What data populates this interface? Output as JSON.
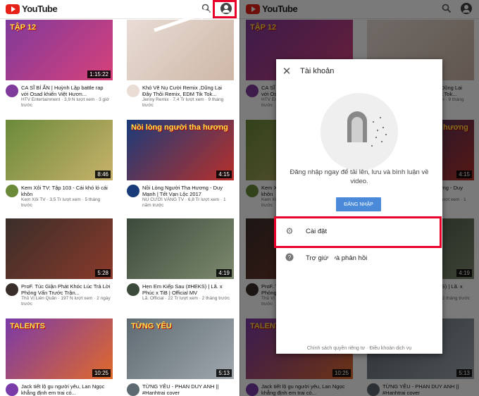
{
  "app": {
    "name": "YouTube"
  },
  "videos": [
    {
      "title": "CA SĨ BÍ ẨN | Huỳnh Lập battle rap với Osad khiến Việt Hươn...",
      "sub": "HTV Entertainment · 3,9 N lượt xem · 3 giờ trước",
      "duration": "1:15:22",
      "overlay": "TẬP 12",
      "c1": "#7f3a9b",
      "c2": "#d8417a"
    },
    {
      "title": "Khó Vẽ Nụ Cười Remix ,Dũng Lại Đây Thôi Remix, EDM Tik Tok...",
      "sub": "Jenny Remix · 7,4 Tr lượt xem · 9 tháng trước",
      "duration": "",
      "overlay": "",
      "c1": "#e9ddd6",
      "c2": "#cdb6a6"
    },
    {
      "title": "Kem Xôi TV: Tập 103 - Cái khó ló cái khôn",
      "sub": "Kem Xôi TV · 3,5 Tr lượt xem · 5 tháng trước",
      "duration": "8:46",
      "overlay": "",
      "c1": "#6a8a3a",
      "c2": "#c9b26b"
    },
    {
      "title": "Nồi Lòng Người Tha Hương - Duy Mạnh | Tết Vạn Lộc 2017",
      "sub": "NỤ CƯỜI VÀNG TV · 6,8 Tr lượt xem · 1 năm trước",
      "duration": "4:15",
      "overlay": "Nồi lòng người tha hương",
      "c1": "#1a3b7a",
      "c2": "#b8302a"
    },
    {
      "title": "ProF. Túc Giận Phát Khóc Lúc Trả Lời Phỏng Vấn Trước Trận...",
      "sub": "Thủ Vị Liên Quân · 197 N lượt xem · 2 ngày trước",
      "duration": "5:28",
      "overlay": "",
      "c1": "#3a2e2a",
      "c2": "#8a3a2a"
    },
    {
      "title": "Hẹn Em Kiếp Sau (#HEKS) | Lã. x Phúc x TiB | Official MV",
      "sub": "Lã. Official · 22 Tr lượt xem · 2 tháng trước",
      "duration": "4:19",
      "overlay": "",
      "c1": "#3c4a3c",
      "c2": "#7d8a6e"
    },
    {
      "title": "Jack tiết lộ gu người yêu, Lan Ngọc khẳng định em trai có...",
      "sub": "",
      "duration": "10:25",
      "overlay": "TALENTS",
      "c1": "#7a3aa8",
      "c2": "#e06a2a"
    },
    {
      "title": "TỪNG YÊU - PHAN DUY ANH || #Hanhtrai cover",
      "sub": "",
      "duration": "5:13",
      "overlay": "TỪNG YÊU",
      "c1": "#5e6a72",
      "c2": "#a0a8ae"
    }
  ],
  "dialog": {
    "close": "✕",
    "title": "Tài khoản",
    "signin_prompt": "Đăng nhập ngay để tải lên, lưu và bình luận về video.",
    "signin_button": "ĐĂNG NHẬP",
    "settings_label": "Cài đặt",
    "help_label": "Trợ giúp và phản hồi",
    "footer": "Chính sách quyền riêng tư · Điều khoản dịch vụ"
  },
  "colors": {
    "accent": "#e62117",
    "highlight": "#e8002a",
    "button": "#4a8ad8"
  }
}
